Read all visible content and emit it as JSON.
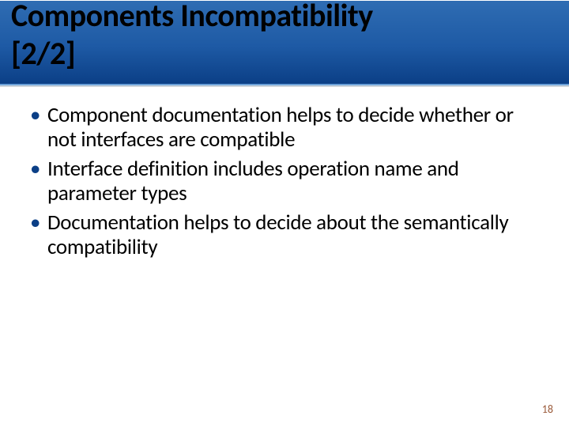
{
  "title": {
    "line1": "Components Incompatibility",
    "line2": "[2/2]"
  },
  "bullets": [
    "Component documentation helps to decide whether or not interfaces are compatible",
    "Interface definition includes operation name and parameter types",
    "Documentation helps to decide about the semantically compatibility"
  ],
  "page_number": "18",
  "colors": {
    "title_band_top": "#2f6db3",
    "title_band_bottom": "#0b3f86",
    "bullet_color": "#0b3f86",
    "page_number_color": "#9a5a3a"
  }
}
